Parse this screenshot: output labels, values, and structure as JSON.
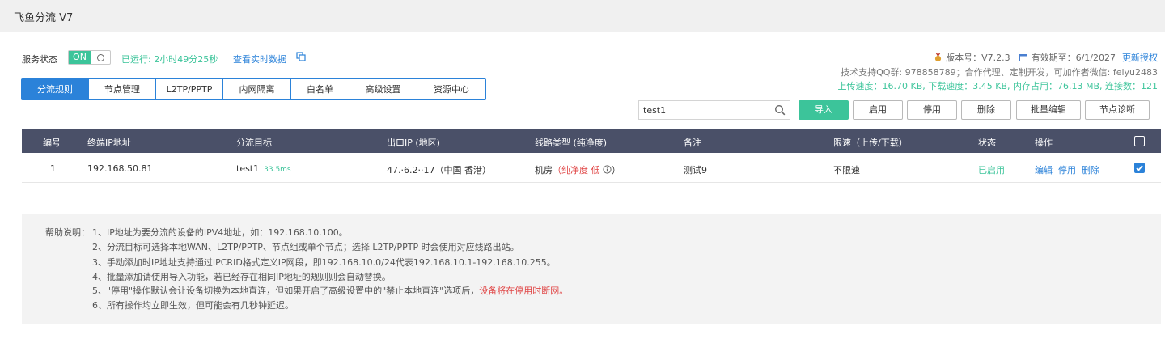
{
  "app": {
    "title": "飞鱼分流 V7"
  },
  "service": {
    "label": "服务状态",
    "toggle_on": "ON",
    "running": "已运行: 2小时49分25秒",
    "realtime_link": "查看实时数据"
  },
  "info": {
    "version": "版本号：V7.2.3",
    "expiry": "有效期至：6/1/2027",
    "renew": "更新授权",
    "support": "技术支持QQ群: 978858789；合作代理、定制开发，可加作者微信: feiyu2483",
    "stats": "上传速度：16.70 KB, 下载速度：3.45 KB, 内存占用：76.13 MB, 连接数：121"
  },
  "tabs": [
    {
      "label": "分流规则",
      "active": true
    },
    {
      "label": "节点管理"
    },
    {
      "label": "L2TP/PPTP"
    },
    {
      "label": "内网隔离"
    },
    {
      "label": "白名单"
    },
    {
      "label": "高级设置"
    },
    {
      "label": "资源中心"
    }
  ],
  "search": {
    "value": "test1"
  },
  "buttons": {
    "import": "导入",
    "enable": "启用",
    "disable": "停用",
    "delete": "删除",
    "batch_edit": "批量编辑",
    "diagnose": "节点诊断"
  },
  "table": {
    "headers": {
      "id": "编号",
      "ip": "终端IP地址",
      "target": "分流目标",
      "exit_ip": "出口IP (地区)",
      "line_type": "线路类型 (纯净度)",
      "remark": "备注",
      "limit": "限速（上传/下载）",
      "status": "状态",
      "ops": "操作"
    },
    "rows": [
      {
        "id": "1",
        "ip": "192.168.50.81",
        "target": "test1",
        "latency": "33.5ms",
        "exit_ip": "47.·6.2··17（中国 香港）",
        "line_type": "机房",
        "purity": "（纯净度 低",
        "purity_end": "）",
        "remark": "测试9",
        "limit": "不限速",
        "status": "已启用",
        "op_edit": "编辑",
        "op_disable": "停用",
        "op_delete": "删除",
        "checked": true
      }
    ]
  },
  "help": {
    "title": "帮助说明：",
    "lines": [
      "1、IP地址为要分流的设备的IPV4地址，如：192.168.10.100。",
      "2、分流目标可选择本地WAN、L2TP/PPTP、节点组或单个节点；选择 L2TP/PPTP 时会使用对应线路出站。",
      "3、手动添加时IP地址支持通过IPCRID格式定义IP网段，即192.168.10.0/24代表192.168.10.1-192.168.10.255。",
      "4、批量添加请使用导入功能，若已经存在相同IP地址的规则则会自动替换。",
      "5、\"停用\"操作默认会让设备切换为本地直连，但如果开启了高级设置中的\"禁止本地直连\"选项后，",
      "6、所有操作均立即生效，但可能会有几秒钟延迟。"
    ],
    "line5_warning": "设备将在停用时断网。"
  },
  "colors": {
    "accent": "#2b82d9",
    "green": "#3cc49a",
    "header_bg": "#4a5068",
    "warning": "#e04545"
  }
}
